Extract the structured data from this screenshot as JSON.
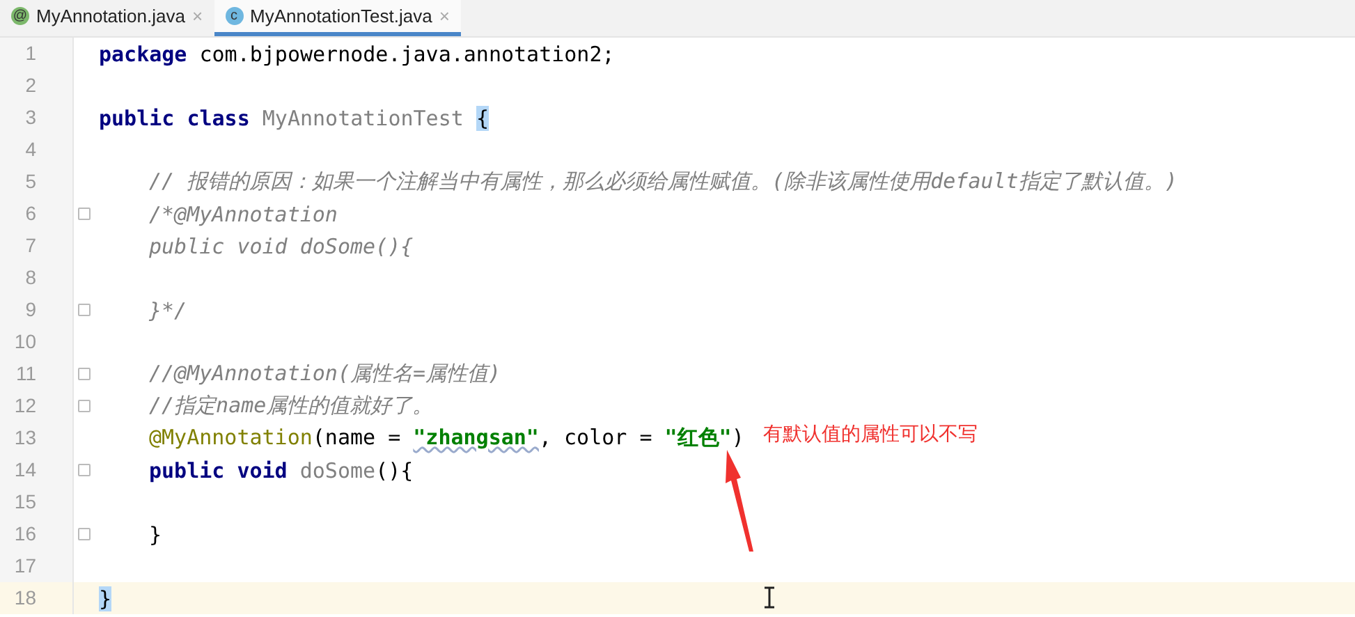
{
  "tabs": [
    {
      "label": "MyAnnotation.java",
      "icon_glyph": "@",
      "kind": "annotation",
      "selected": false,
      "close": "×"
    },
    {
      "label": "MyAnnotationTest.java",
      "icon_glyph": "c",
      "kind": "class",
      "selected": true,
      "close": "×"
    }
  ],
  "editor": {
    "lines": [
      {
        "number": "1",
        "fold": false,
        "current": false,
        "indented": false,
        "tokens": [
          {
            "kind": "keyword",
            "text": "package"
          },
          {
            "kind": "plain",
            "text": " com.bjpowernode.java.annotation2;"
          }
        ]
      },
      {
        "number": "2",
        "fold": false,
        "current": false
      },
      {
        "number": "3",
        "fold": false,
        "current": false,
        "indented": false,
        "tokens": [
          {
            "kind": "keyword",
            "text": "public class "
          },
          {
            "kind": "unused",
            "text": "MyAnnotationTest "
          },
          {
            "kind": "brace-match",
            "text": "{"
          }
        ]
      },
      {
        "number": "4",
        "fold": false,
        "current": false
      },
      {
        "number": "5",
        "fold": false,
        "current": false,
        "indented": true,
        "tokens": [
          {
            "kind": "comment",
            "text": "// 报错的原因：如果一个注解当中有属性，那么必须给属性赋值。(除非该属性使用default指定了默认值。)"
          }
        ]
      },
      {
        "number": "6",
        "fold": true,
        "current": false,
        "indented": true,
        "tokens": [
          {
            "kind": "comment",
            "text": "/*@MyAnnotation"
          }
        ]
      },
      {
        "number": "7",
        "fold": false,
        "current": false,
        "indented": true,
        "tokens": [
          {
            "kind": "comment",
            "text": "public void doSome(){"
          }
        ]
      },
      {
        "number": "8",
        "fold": false,
        "current": false
      },
      {
        "number": "9",
        "fold": true,
        "current": false,
        "indented": true,
        "tokens": [
          {
            "kind": "comment",
            "text": "}*/"
          }
        ]
      },
      {
        "number": "10",
        "fold": false,
        "current": false
      },
      {
        "number": "11",
        "fold": true,
        "current": false,
        "indented": true,
        "tokens": [
          {
            "kind": "comment",
            "text": "//@MyAnnotation(属性名=属性值)"
          }
        ]
      },
      {
        "number": "12",
        "fold": true,
        "current": false,
        "indented": true,
        "tokens": [
          {
            "kind": "comment",
            "text": "//指定name属性的值就好了。"
          }
        ]
      },
      {
        "number": "13",
        "fold": false,
        "current": false,
        "indented": true,
        "tokens": [
          {
            "kind": "annotation",
            "text": "@MyAnnotation"
          },
          {
            "kind": "plain",
            "text": "(name = "
          },
          {
            "kind": "string-typo",
            "text": "\"zhangsan\""
          },
          {
            "kind": "plain",
            "text": ", color = "
          },
          {
            "kind": "string",
            "text": "\"红色\""
          },
          {
            "kind": "plain",
            "text": ")"
          }
        ]
      },
      {
        "number": "14",
        "fold": true,
        "current": false,
        "indented": true,
        "tokens": [
          {
            "kind": "keyword",
            "text": "public void "
          },
          {
            "kind": "unused",
            "text": "doSome"
          },
          {
            "kind": "plain",
            "text": "(){"
          }
        ]
      },
      {
        "number": "15",
        "fold": false,
        "current": false
      },
      {
        "number": "16",
        "fold": true,
        "current": false,
        "indented": true,
        "tokens": [
          {
            "kind": "plain",
            "text": "}"
          }
        ]
      },
      {
        "number": "17",
        "fold": false,
        "current": false
      },
      {
        "number": "18",
        "fold": false,
        "current": true,
        "indented": false,
        "tokens": [
          {
            "kind": "brace-match",
            "text": "}"
          }
        ]
      }
    ]
  },
  "callout": {
    "text": "有默认值的属性可以不写"
  }
}
